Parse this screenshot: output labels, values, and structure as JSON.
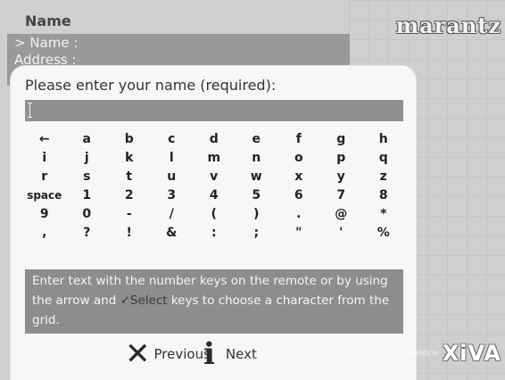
{
  "header": {
    "title": "Name",
    "brand": "marantz"
  },
  "background_menu": {
    "items": [
      "> Name :",
      "Address :"
    ]
  },
  "dialog": {
    "prompt": "Please enter your name (required):",
    "input_value": ""
  },
  "keyboard": {
    "rows": [
      [
        "←",
        "a",
        "b",
        "c",
        "d",
        "e",
        "f",
        "g",
        "h"
      ],
      [
        "i",
        "j",
        "k",
        "l",
        "m",
        "n",
        "o",
        "p",
        "q"
      ],
      [
        "r",
        "s",
        "t",
        "u",
        "v",
        "w",
        "x",
        "y",
        "z"
      ],
      [
        "space",
        "1",
        "2",
        "3",
        "4",
        "5",
        "6",
        "7",
        "8"
      ],
      [
        "9",
        "0",
        "-",
        "/",
        "(",
        ")",
        ".",
        "@",
        "*"
      ],
      [
        ",",
        "?",
        "!",
        "&",
        ":",
        ";",
        "\"",
        "'",
        "%"
      ]
    ]
  },
  "help": {
    "text_before": "Enter text with the number keys on the remote or by using the arrow and ",
    "checkmark": "✓",
    "select_word": "Select",
    "text_after": " keys to choose a character from the grid."
  },
  "footer": {
    "previous_label": "Previous",
    "next_label": "Next",
    "powered_by": "POWERED BY",
    "powered_brand": "XiVA"
  }
}
